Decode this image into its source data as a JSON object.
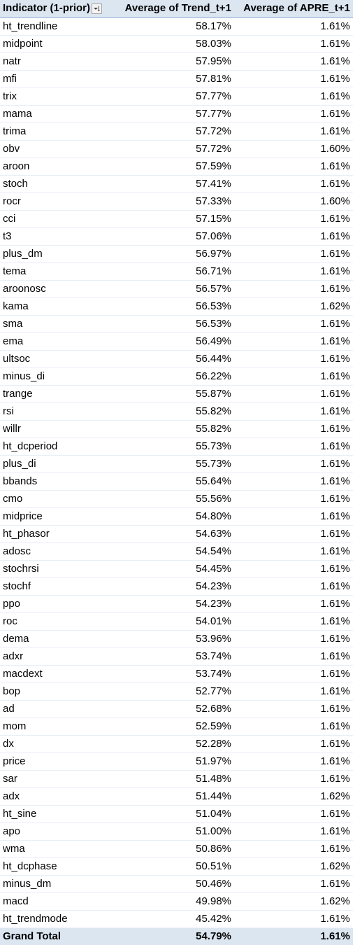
{
  "pivot": {
    "headers": {
      "indicator": "Indicator (1-prior)",
      "trend": "Average of Trend_t+1",
      "apre": "Average of APRE_t+1"
    },
    "sort_icon": "filter-sort-descending-icon",
    "rows": [
      {
        "indicator": "ht_trendline",
        "trend": "58.17%",
        "apre": "1.61%"
      },
      {
        "indicator": "midpoint",
        "trend": "58.03%",
        "apre": "1.61%"
      },
      {
        "indicator": "natr",
        "trend": "57.95%",
        "apre": "1.61%"
      },
      {
        "indicator": "mfi",
        "trend": "57.81%",
        "apre": "1.61%"
      },
      {
        "indicator": "trix",
        "trend": "57.77%",
        "apre": "1.61%"
      },
      {
        "indicator": "mama",
        "trend": "57.77%",
        "apre": "1.61%"
      },
      {
        "indicator": "trima",
        "trend": "57.72%",
        "apre": "1.61%"
      },
      {
        "indicator": "obv",
        "trend": "57.72%",
        "apre": "1.60%"
      },
      {
        "indicator": "aroon",
        "trend": "57.59%",
        "apre": "1.61%"
      },
      {
        "indicator": "stoch",
        "trend": "57.41%",
        "apre": "1.61%"
      },
      {
        "indicator": "rocr",
        "trend": "57.33%",
        "apre": "1.60%"
      },
      {
        "indicator": "cci",
        "trend": "57.15%",
        "apre": "1.61%"
      },
      {
        "indicator": "t3",
        "trend": "57.06%",
        "apre": "1.61%"
      },
      {
        "indicator": "plus_dm",
        "trend": "56.97%",
        "apre": "1.61%"
      },
      {
        "indicator": "tema",
        "trend": "56.71%",
        "apre": "1.61%"
      },
      {
        "indicator": "aroonosc",
        "trend": "56.57%",
        "apre": "1.61%"
      },
      {
        "indicator": "kama",
        "trend": "56.53%",
        "apre": "1.62%"
      },
      {
        "indicator": "sma",
        "trend": "56.53%",
        "apre": "1.61%"
      },
      {
        "indicator": "ema",
        "trend": "56.49%",
        "apre": "1.61%"
      },
      {
        "indicator": "ultsoc",
        "trend": "56.44%",
        "apre": "1.61%"
      },
      {
        "indicator": "minus_di",
        "trend": "56.22%",
        "apre": "1.61%"
      },
      {
        "indicator": "trange",
        "trend": "55.87%",
        "apre": "1.61%"
      },
      {
        "indicator": "rsi",
        "trend": "55.82%",
        "apre": "1.61%"
      },
      {
        "indicator": "willr",
        "trend": "55.82%",
        "apre": "1.61%"
      },
      {
        "indicator": "ht_dcperiod",
        "trend": "55.73%",
        "apre": "1.61%"
      },
      {
        "indicator": "plus_di",
        "trend": "55.73%",
        "apre": "1.61%"
      },
      {
        "indicator": "bbands",
        "trend": "55.64%",
        "apre": "1.61%"
      },
      {
        "indicator": "cmo",
        "trend": "55.56%",
        "apre": "1.61%"
      },
      {
        "indicator": "midprice",
        "trend": "54.80%",
        "apre": "1.61%"
      },
      {
        "indicator": "ht_phasor",
        "trend": "54.63%",
        "apre": "1.61%"
      },
      {
        "indicator": "adosc",
        "trend": "54.54%",
        "apre": "1.61%"
      },
      {
        "indicator": "stochrsi",
        "trend": "54.45%",
        "apre": "1.61%"
      },
      {
        "indicator": "stochf",
        "trend": "54.23%",
        "apre": "1.61%"
      },
      {
        "indicator": "ppo",
        "trend": "54.23%",
        "apre": "1.61%"
      },
      {
        "indicator": "roc",
        "trend": "54.01%",
        "apre": "1.61%"
      },
      {
        "indicator": "dema",
        "trend": "53.96%",
        "apre": "1.61%"
      },
      {
        "indicator": "adxr",
        "trend": "53.74%",
        "apre": "1.61%"
      },
      {
        "indicator": "macdext",
        "trend": "53.74%",
        "apre": "1.61%"
      },
      {
        "indicator": "bop",
        "trend": "52.77%",
        "apre": "1.61%"
      },
      {
        "indicator": "ad",
        "trend": "52.68%",
        "apre": "1.61%"
      },
      {
        "indicator": "mom",
        "trend": "52.59%",
        "apre": "1.61%"
      },
      {
        "indicator": "dx",
        "trend": "52.28%",
        "apre": "1.61%"
      },
      {
        "indicator": "price",
        "trend": "51.97%",
        "apre": "1.61%"
      },
      {
        "indicator": "sar",
        "trend": "51.48%",
        "apre": "1.61%"
      },
      {
        "indicator": "adx",
        "trend": "51.44%",
        "apre": "1.62%"
      },
      {
        "indicator": "ht_sine",
        "trend": "51.04%",
        "apre": "1.61%"
      },
      {
        "indicator": "apo",
        "trend": "51.00%",
        "apre": "1.61%"
      },
      {
        "indicator": "wma",
        "trend": "50.86%",
        "apre": "1.61%"
      },
      {
        "indicator": "ht_dcphase",
        "trend": "50.51%",
        "apre": "1.62%"
      },
      {
        "indicator": "minus_dm",
        "trend": "50.46%",
        "apre": "1.61%"
      },
      {
        "indicator": "macd",
        "trend": "49.98%",
        "apre": "1.62%"
      },
      {
        "indicator": "ht_trendmode",
        "trend": "45.42%",
        "apre": "1.61%"
      }
    ],
    "grand_total": {
      "label": "Grand Total",
      "trend": "54.79%",
      "apre": "1.61%"
    }
  },
  "colors": {
    "header_bg": "#dce6f1",
    "total_bg": "#dce6f1",
    "total_border": "#4f81bd"
  }
}
